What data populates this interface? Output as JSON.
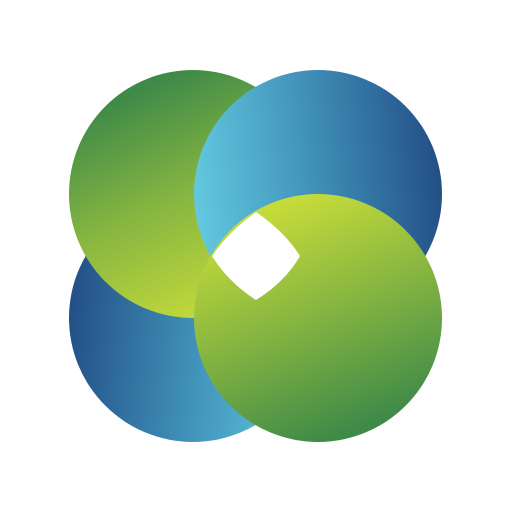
{
  "logo": {
    "icon": "four-interlocking-circles-logo-icon",
    "colors": {
      "green_dark": "#3f8a48",
      "green_light": "#c7dc3a",
      "blue_dark": "#234f86",
      "blue_light": "#63c9e0",
      "background": "#ffffff"
    }
  }
}
